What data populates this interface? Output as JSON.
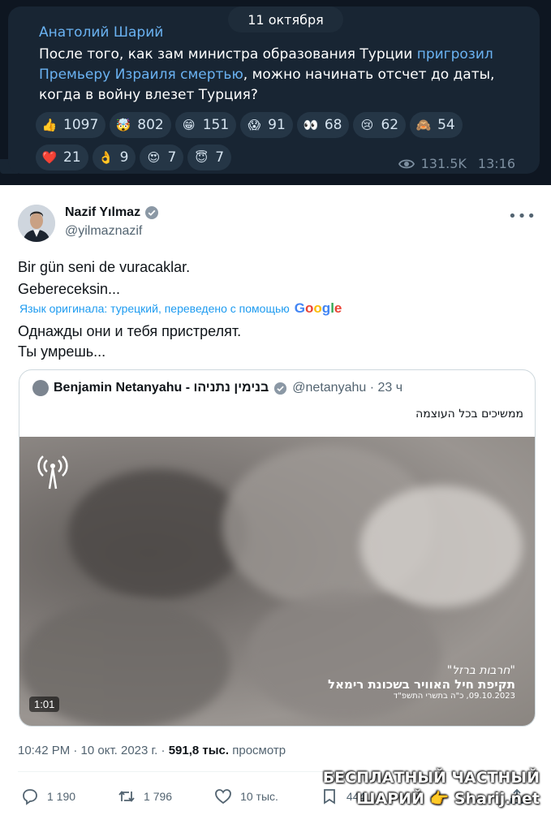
{
  "telegram": {
    "date_pill": "11 октября",
    "author": "Анатолий Шарий",
    "text_part1": "После того, как зам министра образования Турции ",
    "text_link": "пригрозил Премьеру Израиля смертью",
    "text_part2": ", можно начинать отсчет до даты, когда в войну влезет Турция?",
    "reactions_row1": [
      {
        "emoji": "👍",
        "icon": "thumbs-up-icon",
        "count": "1097"
      },
      {
        "emoji": "🤯",
        "icon": "exploding-head-icon",
        "count": "802"
      },
      {
        "emoji": "😁",
        "icon": "grin-icon",
        "count": "151"
      },
      {
        "emoji": "😱",
        "icon": "scream-icon",
        "count": "91"
      },
      {
        "emoji": "👀",
        "icon": "eyes-icon",
        "count": "68"
      },
      {
        "emoji": "😢",
        "icon": "cry-icon",
        "count": "62"
      },
      {
        "emoji": "🙈",
        "icon": "see-no-evil-monkey-icon",
        "count": "54"
      }
    ],
    "reactions_row2": [
      {
        "emoji": "❤️",
        "icon": "heart-icon",
        "count": "21"
      },
      {
        "emoji": "👌",
        "icon": "ok-hand-icon",
        "count": "9"
      },
      {
        "emoji": "😍",
        "icon": "heart-eyes-icon",
        "count": "7"
      },
      {
        "emoji": "😇",
        "icon": "halo-icon",
        "count": "7"
      }
    ],
    "views": "131.5K",
    "time": "13:16",
    "colors": {
      "bubble": "#182533",
      "link": "#6ab2f2",
      "reaction_bg": "#253646"
    }
  },
  "tweet": {
    "name": "Nazif Yılmaz",
    "handle": "@yilmaznazif",
    "body_line1": "Bir gün seni de vuracaklar.",
    "body_line2": "Gebereceksin...",
    "translate_note": "Язык оригинала: турецкий, переведено с помощью",
    "translate_brand": "Google",
    "translation_line1": "Однажды они и тебя пристрелят.",
    "translation_line2": "Ты умрешь...",
    "quote": {
      "name": "Benjamin Netanyahu - בנימין נתניהו",
      "handle_time": "@netanyahu · 23 ч",
      "text": "ממשיכים בכל העוצמה",
      "video_duration": "1:01",
      "caption_line1": "\"חרבות ברזל\"",
      "caption_line2": "תקיפת חיל האוויר בשכונת רימאל",
      "caption_line3": "09.10.2023, כ\"ה בתשרי התשפ\"ד"
    },
    "timestamp": "10:42 PM · 10 окт. 2023 г. · ",
    "views_count": "591,8 тыс.",
    "views_label": " просмотр",
    "actions": {
      "replies": "1 190",
      "retweets": "1 796",
      "likes": "10 тыс.",
      "bookmarks": "444"
    }
  },
  "watermark": {
    "line1": "БЕСПЛАТНЫЙ ЧАСТНЫЙ",
    "line2": "ШАРИЙ",
    "line3": "Sharij.net"
  }
}
